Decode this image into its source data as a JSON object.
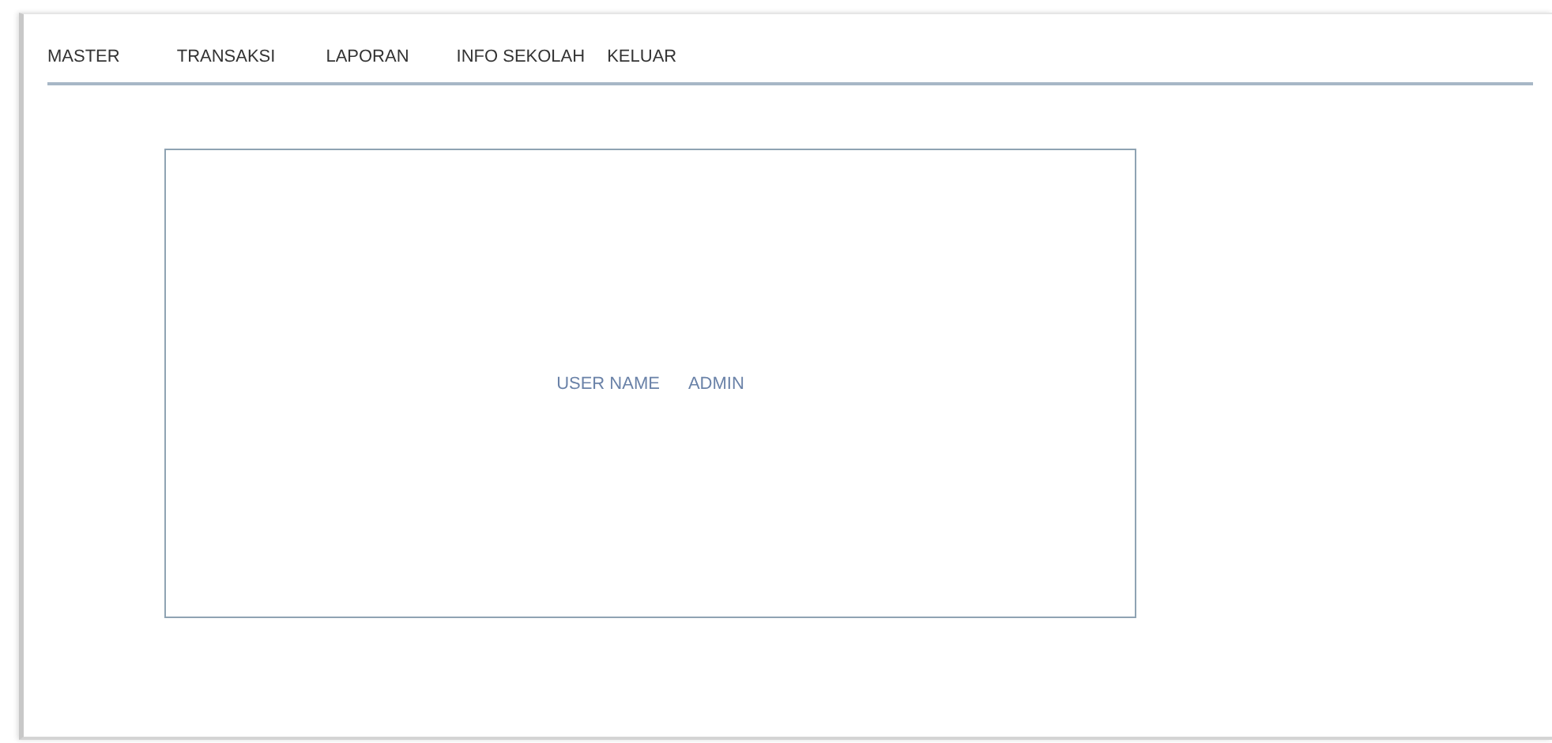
{
  "menu": [
    {
      "label": "MASTER"
    },
    {
      "label": "TRANSAKSI"
    },
    {
      "label": "LAPORAN"
    },
    {
      "label": "INFO SEKOLAH"
    },
    {
      "label": "KELUAR"
    }
  ],
  "login_panel": {
    "label": "USER NAME",
    "value": "ADMIN"
  }
}
